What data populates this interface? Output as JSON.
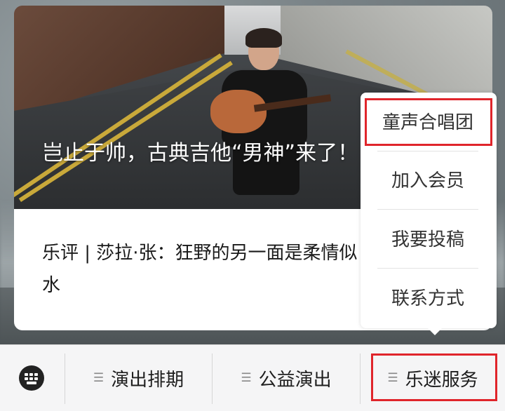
{
  "article": {
    "title": "岂止于帅，古典吉他“男神”来了！",
    "summary": "乐评 | 莎拉·张：狂野的另一面是柔情似水"
  },
  "popup_menu": {
    "items": [
      {
        "label": "童声合唱团",
        "highlighted": true
      },
      {
        "label": "加入会员",
        "highlighted": false
      },
      {
        "label": "我要投稿",
        "highlighted": false
      },
      {
        "label": "联系方式",
        "highlighted": false
      }
    ],
    "highlight_color": "#e0252b"
  },
  "bottom_menu": {
    "keyboard_icon": "keyboard-icon",
    "tabs": [
      {
        "label": "演出排期",
        "icon": "menu-lines-icon"
      },
      {
        "label": "公益演出",
        "icon": "menu-lines-icon"
      },
      {
        "label": "乐迷服务",
        "icon": "menu-lines-icon",
        "highlighted": true
      }
    ]
  }
}
